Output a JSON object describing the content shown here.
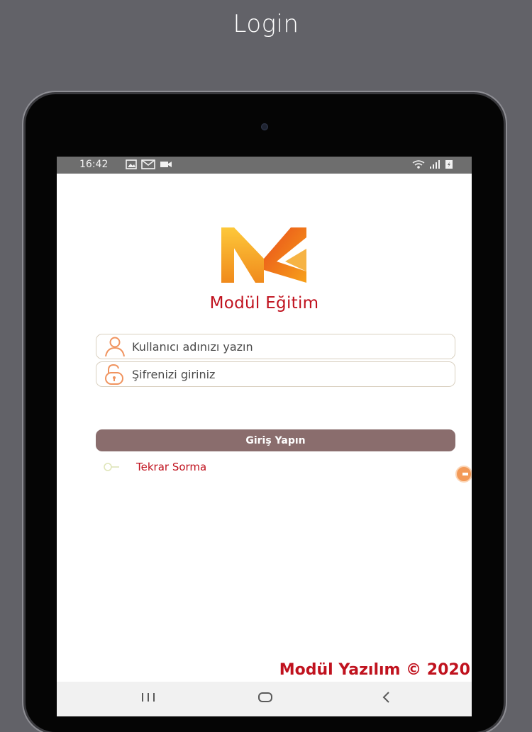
{
  "caption": "Login",
  "status_bar": {
    "time": "16:42",
    "icons": [
      "image-icon",
      "mail-icon",
      "video-icon",
      "wifi-icon",
      "signal-icon",
      "battery-icon"
    ]
  },
  "app": {
    "brand_name": "Modül Eğitim",
    "username_placeholder": "Kullanıcı adınızı yazın",
    "password_placeholder": "Şifrenizi giriniz",
    "login_button": "Giriş Yapın",
    "remember_label": "Tekrar Sorma",
    "footer": "Modül Yazılım © 2020"
  },
  "nav_bar": {
    "buttons": [
      "recent-apps-icon",
      "home-icon",
      "back-icon"
    ]
  },
  "colors": {
    "background": "#626268",
    "accent_red": "#c0121e",
    "button": "#8a6d6d",
    "logo_orange": "#f5a623",
    "icon_orange": "#f0935e"
  }
}
